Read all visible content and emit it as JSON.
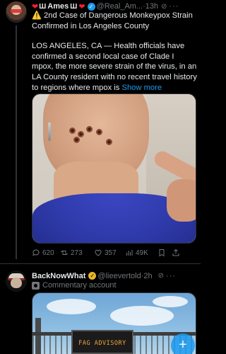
{
  "post1": {
    "display_name": "Ames",
    "handle": "@Real_Am...",
    "time": "13h",
    "more": "···",
    "warning_icon": "⚠️",
    "headline": "2nd Case of Dangerous Monkeypox Strain Confirmed in Los Angeles County",
    "body": "LOS ANGELES, CA — Health officials have confirmed a second local case of Clade I mpox, the more severe strain of the virus, in an LA County resident with no recent travel history to regions where mpox is",
    "show_more": "Show more",
    "stats": {
      "replies": "620",
      "reposts": "273",
      "likes": "357",
      "views": "49K"
    }
  },
  "post2": {
    "display_name": "BackNowWhat",
    "handle": "@lieevertold",
    "time": "2h",
    "more": "···",
    "subtitle": "Commentary account",
    "sign_text": "FAG ADVISORY"
  },
  "colors": {
    "accent": "#1d9bf0",
    "background": "#000000",
    "text": "#e7e9ea",
    "muted": "#71767b",
    "like_heart": "#f4212e",
    "gold_verified": "#e8b52e"
  }
}
